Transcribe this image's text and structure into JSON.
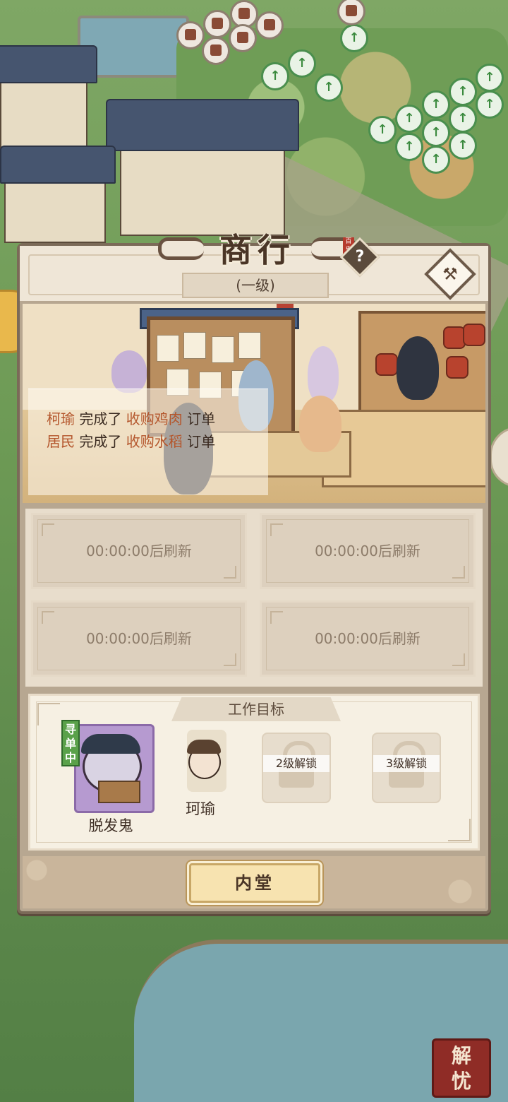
{
  "panel": {
    "title": "商行",
    "title_stamp": "百鬼",
    "help_label": "?",
    "level": "(一级)",
    "hammer_icon": "hammer-icon"
  },
  "news": [
    {
      "who": "柯瑜",
      "verb": "完成了",
      "order": "收购鸡肉",
      "suffix": "订单"
    },
    {
      "who": "居民",
      "verb": "完成了",
      "order": "收购水稻",
      "suffix": "订单"
    }
  ],
  "order_slots": [
    {
      "text": "00:00:00后刷新"
    },
    {
      "text": "00:00:00后刷新"
    },
    {
      "text": "00:00:00后刷新"
    },
    {
      "text": "00:00:00后刷新"
    }
  ],
  "work_goals": {
    "title": "工作目标",
    "worker": {
      "tag": "寻单中",
      "name": "脱发鬼"
    },
    "peek_name": "珂瑜",
    "locked": [
      {
        "label": "2级解锁"
      },
      {
        "label": "3级解锁"
      }
    ]
  },
  "bottom": {
    "inner_button": "内堂"
  },
  "corner_seal": {
    "line1": "解",
    "line2": "忧"
  }
}
